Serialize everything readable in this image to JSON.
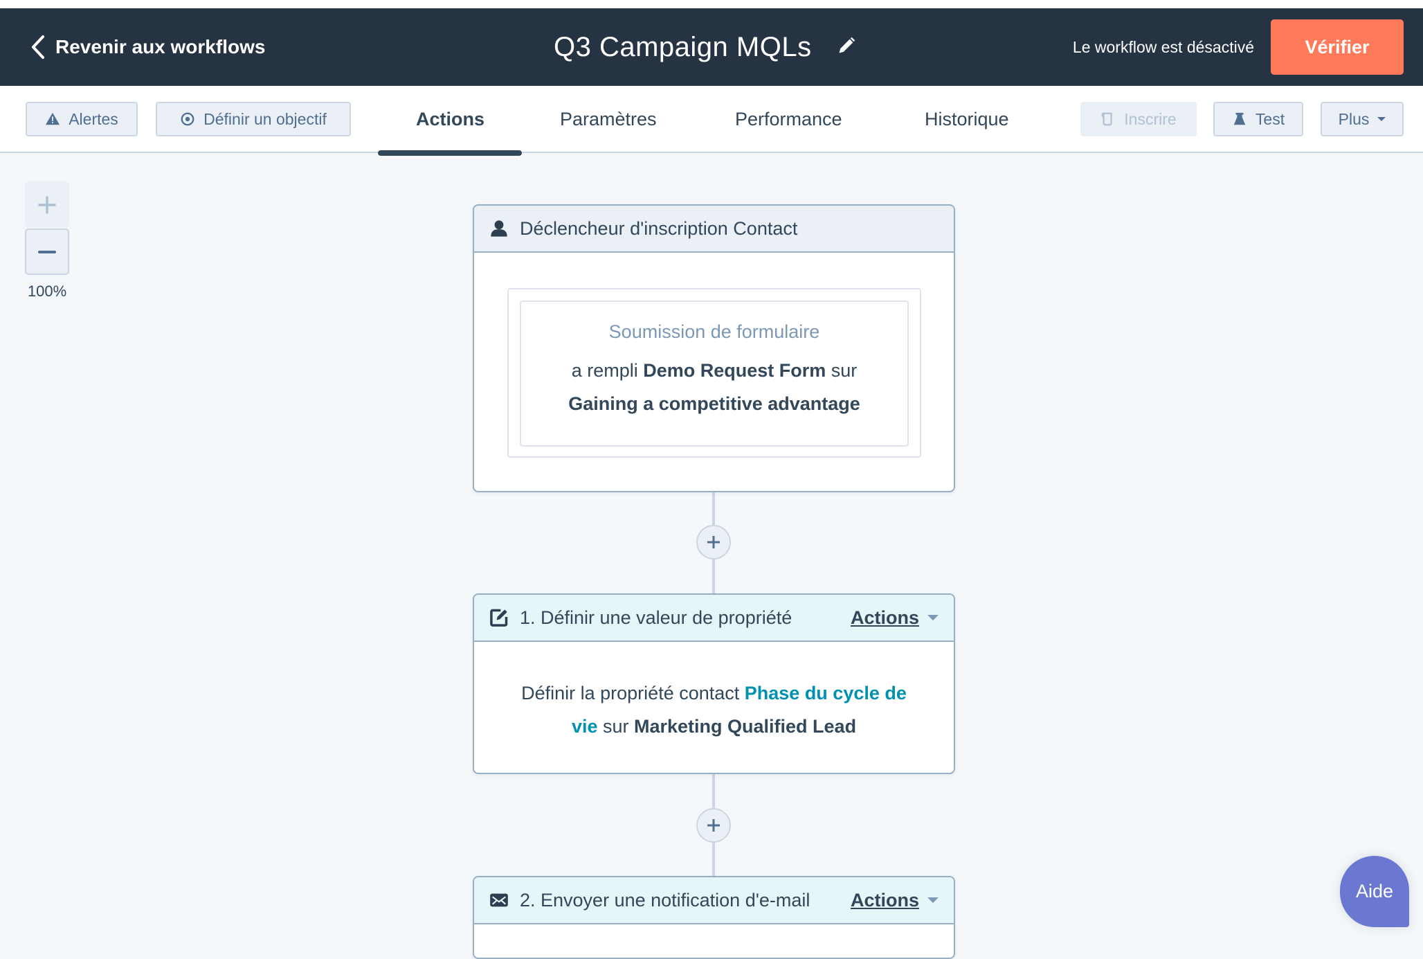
{
  "header": {
    "back_label": "Revenir aux workflows",
    "title": "Q3 Campaign MQLs",
    "status": "Le workflow est désactivé",
    "verify_label": "Vérifier"
  },
  "toolbar": {
    "alerts_label": "Alertes",
    "goal_label": "Définir un objectif",
    "tabs": [
      {
        "label": "Actions",
        "active": true
      },
      {
        "label": "Paramètres",
        "active": false
      },
      {
        "label": "Performance",
        "active": false
      },
      {
        "label": "Historique",
        "active": false
      }
    ],
    "enroll_label": "Inscrire",
    "test_label": "Test",
    "more_label": "Plus"
  },
  "zoom": {
    "level": "100%"
  },
  "trigger": {
    "title": "Déclencheur d'inscription Contact",
    "filter_type": "Soumission de formulaire",
    "desc_prefix": "a rempli ",
    "form_name": "Demo Request Form",
    "desc_mid": " sur ",
    "page_name": "Gaining a competitive advantage"
  },
  "steps": [
    {
      "title": "1. Définir une valeur de propriété",
      "actions_label": "Actions",
      "body_prefix": "Définir la propriété contact ",
      "property": "Phase du cycle de vie",
      "body_mid": " sur ",
      "value": "Marketing Qualified Lead"
    },
    {
      "title": "2. Envoyer une notification d'e-mail",
      "actions_label": "Actions"
    }
  ],
  "help": {
    "label": "Aide"
  },
  "colors": {
    "header_bg": "#253342",
    "primary_orange": "#ff7a59",
    "link_teal": "#0091ae",
    "help_purple": "#6a78d1"
  }
}
